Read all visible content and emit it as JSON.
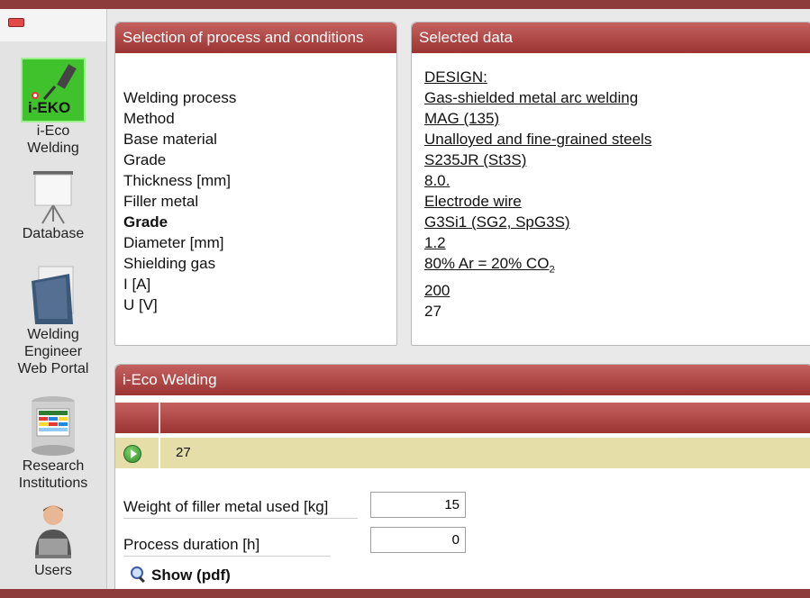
{
  "sidebar": {
    "items": [
      {
        "label": "i-Eco\nWelding",
        "icon": "i-eko-logo-icon",
        "logo_text": "i-EKO"
      },
      {
        "label": "Database",
        "icon": "projector-screen-icon"
      },
      {
        "label": "Welding\nEngineer\nWeb Portal",
        "icon": "binder-icon"
      },
      {
        "label": "Research\nInstitutions",
        "icon": "spreadsheet-icon"
      },
      {
        "label": "Users",
        "icon": "user-laptop-icon"
      }
    ]
  },
  "selection_panel": {
    "title": "Selection of process and conditions",
    "labels": [
      "Welding process",
      "Method",
      "Base material",
      "Grade",
      "Thickness [mm]",
      "Filler metal",
      "Grade",
      "Diameter [mm]",
      "Shielding gas",
      "I [A]",
      "U [V]"
    ]
  },
  "selected_panel": {
    "title": "Selected data",
    "values": [
      "DESIGN:",
      "Gas-shielded metal arc welding",
      "MAG (135)",
      "Unalloyed and fine-grained steels",
      "S235JR (St3S)",
      "8.0.",
      "Electrode wire",
      "G3Si1 (SG2, SpG3S)",
      "1.2"
    ],
    "gas": {
      "text": "80% Ar = 20% CO",
      "subscript": "2"
    },
    "current": "200",
    "voltage": "27"
  },
  "eco_panel": {
    "title": "i-Eco Welding",
    "row_value": "27",
    "weight_label": "Weight of filler metal used [kg]",
    "weight_value": "15",
    "duration_label": "Process duration [h]",
    "duration_value": "0",
    "show_pdf_label": "Show (pdf)"
  },
  "colors": {
    "header_top": "#c4615f",
    "header_bottom": "#9b3433",
    "row_highlight": "#e6dea9",
    "logo_green": "#3fc22b"
  }
}
